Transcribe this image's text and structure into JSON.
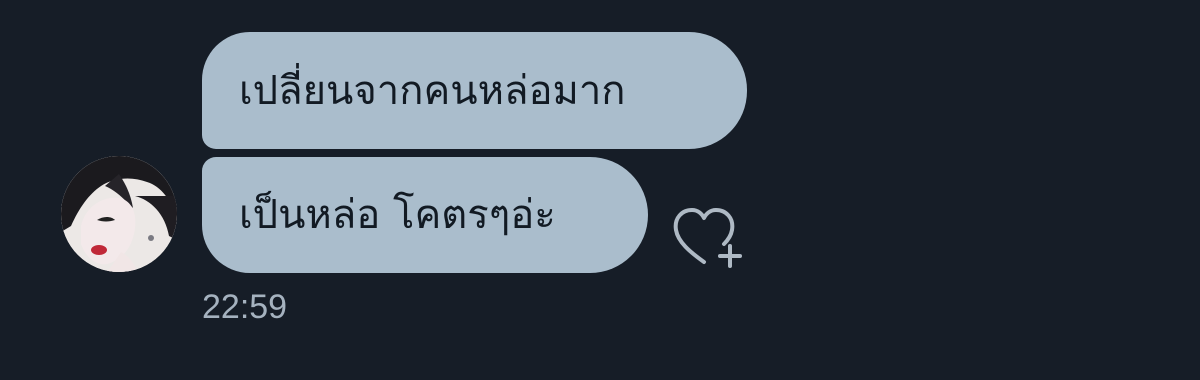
{
  "sender": {
    "avatar_icon": "avatar-photo"
  },
  "messages": [
    {
      "text": "เปลี่ยนจากคนหล่อมาก"
    },
    {
      "text": "เป็นหล่อ โคตรๆอ่ะ"
    }
  ],
  "reaction": {
    "icon": "heart-plus-icon"
  },
  "timestamp": "22:59",
  "colors": {
    "background": "#161d27",
    "bubble": "#aabdcc",
    "bubble_text": "#121a23",
    "timestamp": "#a5b2bf",
    "icon": "#aeb9c4"
  }
}
